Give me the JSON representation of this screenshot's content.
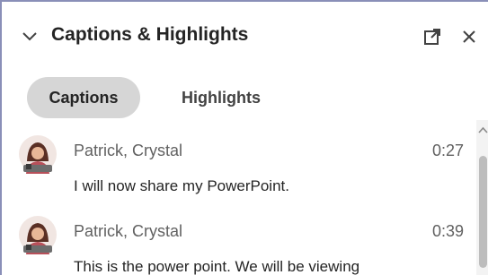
{
  "panel": {
    "title": "Captions & Highlights",
    "collapse_icon": "chevron-down-icon",
    "popout_icon": "pop-out-icon",
    "close_icon": "close-icon"
  },
  "tabs": [
    {
      "label": "Captions",
      "active": true
    },
    {
      "label": "Highlights",
      "active": false
    }
  ],
  "messages": [
    {
      "sender": "Patrick, Crystal",
      "time": "0:27",
      "text": "I will now share my PowerPoint.",
      "avatar_icon": "avatar-icon"
    },
    {
      "sender": "Patrick, Crystal",
      "time": "0:39",
      "text": "This is the power point. We will be viewing",
      "avatar_icon": "avatar-icon"
    }
  ],
  "scrollbar": {
    "position_fraction": 0.15
  }
}
